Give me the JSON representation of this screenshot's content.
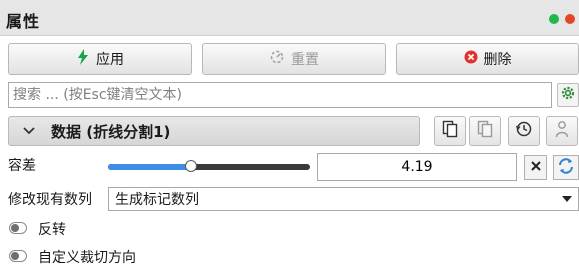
{
  "panel": {
    "title": "属性",
    "colors": {
      "accent": "#3d8ee8",
      "green_dot": "#1fb84b",
      "red_dot": "#e4462a"
    }
  },
  "toolbar": {
    "apply_label": "应用",
    "apply_icon": "lightning-icon",
    "reset_label": "重置",
    "reset_icon": "reset-icon",
    "delete_label": "删除",
    "delete_icon": "delete-circle-icon"
  },
  "search": {
    "placeholder": "搜索 ... (按Esc键清空文本)",
    "settings_icon": "gear-icon"
  },
  "section": {
    "title": "数据 (折线分割1)",
    "expanded": true,
    "tools": [
      "copy-icon",
      "paste-icon",
      "history-icon",
      "user-icon"
    ]
  },
  "properties": {
    "tolerance": {
      "label": "容差",
      "value": "4.19",
      "slider_fraction": 0.41
    },
    "modify_arrays": {
      "label": "修改现有数列",
      "selected": "生成标记数列"
    },
    "reverse": {
      "label": "反转",
      "checked": false
    },
    "custom_cut_direction": {
      "label": "自定义裁切方向",
      "checked": false
    }
  }
}
